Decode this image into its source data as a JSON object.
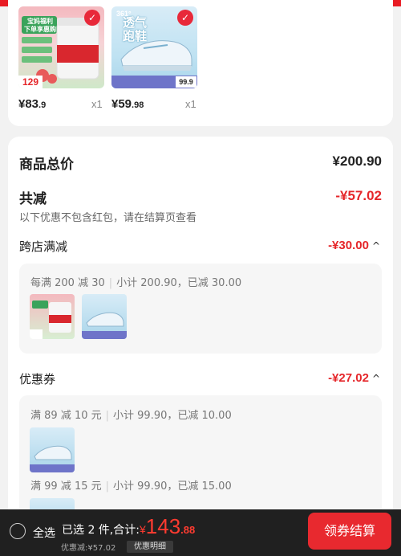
{
  "cart": {
    "items": [
      {
        "price_main": "¥83",
        "price_dec": ".9",
        "qty": "x1",
        "badge_number": "129",
        "image_text": [
          "宝妈福利",
          "下单享惠购"
        ]
      },
      {
        "price_main": "¥59",
        "price_dec": ".98",
        "qty": "x1",
        "badge_number": "99.9",
        "brand": "361°",
        "image_text": [
          "透气",
          "跑鞋"
        ]
      }
    ]
  },
  "summary": {
    "total_label": "商品总价",
    "total_value": "¥200.90",
    "discount_label": "共减",
    "discount_value": "-¥57.02",
    "discount_note": "以下优惠不包含红包，请在结算页查看"
  },
  "cross_store": {
    "label": "跨店满减",
    "value": "-¥30.00",
    "rule": "每满 200 减 30",
    "subtotal": "小计 200.90，已减 30.00"
  },
  "coupon": {
    "label": "优惠券",
    "value": "-¥27.02",
    "lines": [
      {
        "rule": "满 89 减 10 元",
        "subtotal": "小计 99.90，已减 10.00"
      },
      {
        "rule": "满 99 减 15 元",
        "subtotal": "小计 99.90，已减 15.00"
      }
    ]
  },
  "bottom": {
    "select_all": "全选",
    "selected": "已选 2 件,",
    "total_label": "合计:",
    "currency": "¥",
    "total_int": "143",
    "total_dec": ".88",
    "discount": "优惠减:¥57.02",
    "detail": "优惠明细",
    "checkout": "领券结算"
  },
  "colors": {
    "accent": "#e5262a",
    "bar": "#202020"
  }
}
